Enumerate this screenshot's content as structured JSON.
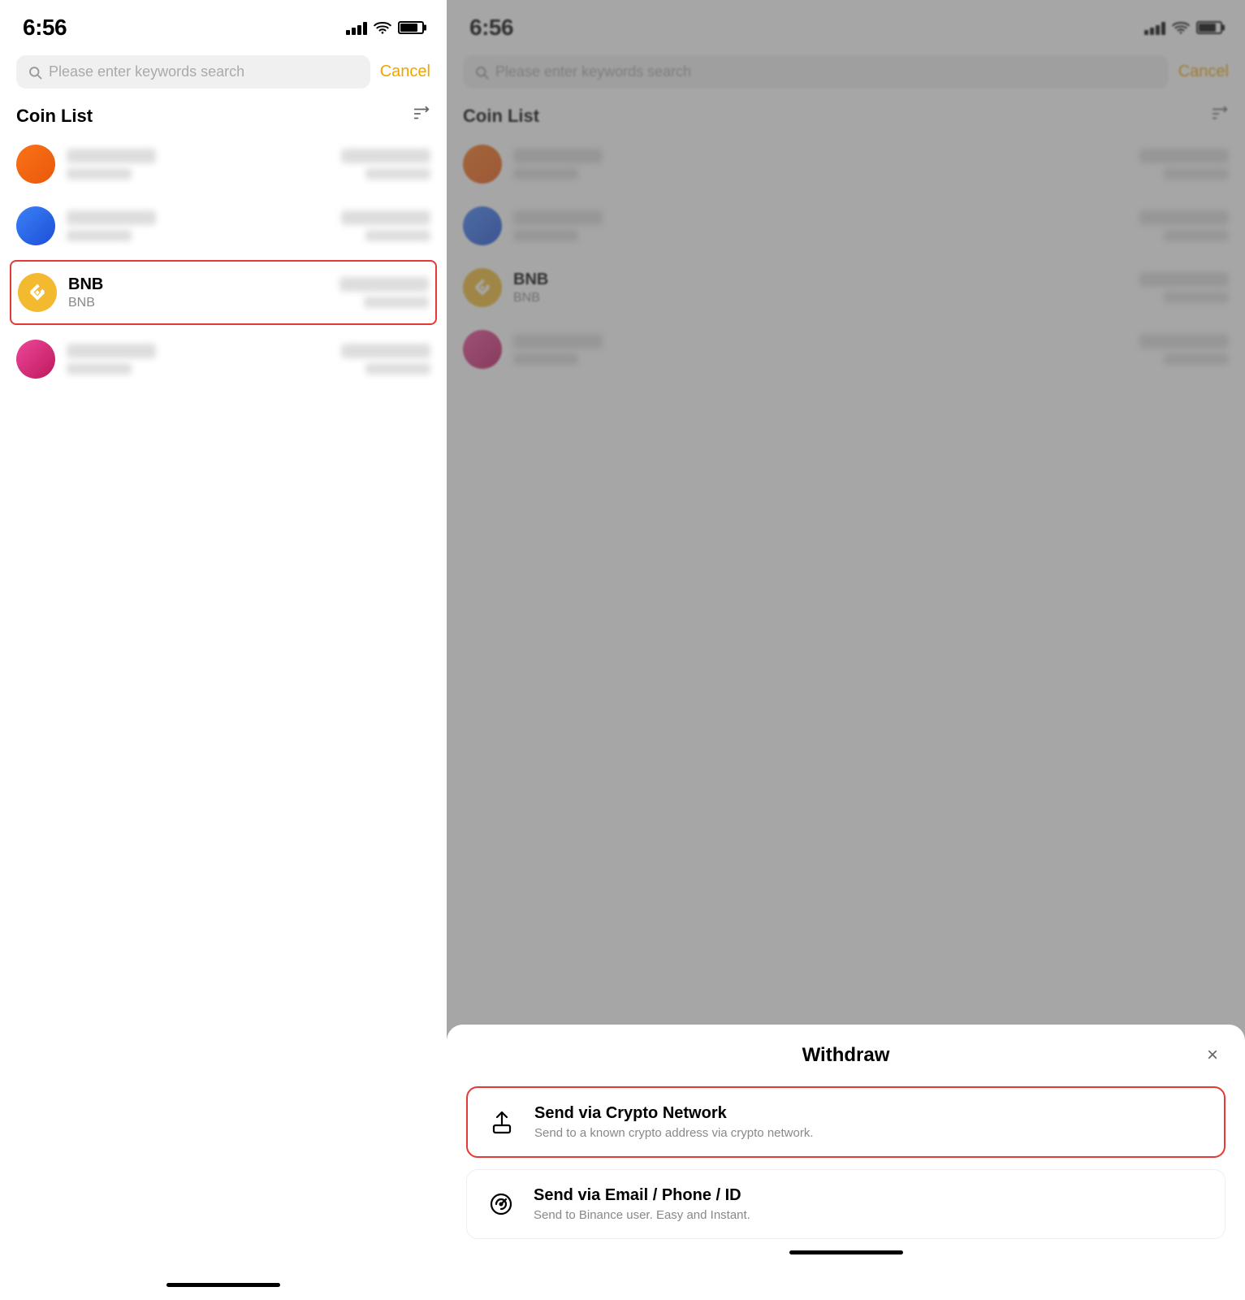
{
  "left_panel": {
    "status_bar": {
      "time": "6:56"
    },
    "search": {
      "placeholder": "Please enter keywords search",
      "cancel_label": "Cancel"
    },
    "coin_list": {
      "title": "Coin List",
      "coins": [
        {
          "id": "coin1",
          "color": "orange",
          "name": "",
          "symbol": "",
          "highlighted": false
        },
        {
          "id": "coin2",
          "color": "blue",
          "name": "",
          "symbol": "",
          "highlighted": false
        },
        {
          "id": "bnb",
          "color": "bnb",
          "name": "BNB",
          "symbol": "BNB",
          "highlighted": true
        },
        {
          "id": "coin4",
          "color": "pink",
          "name": "",
          "symbol": "",
          "highlighted": false
        }
      ]
    },
    "home_indicator": ""
  },
  "right_panel": {
    "status_bar": {
      "time": "6:56"
    },
    "search": {
      "placeholder": "Please enter keywords search",
      "cancel_label": "Cancel"
    },
    "coin_list": {
      "title": "Coin List",
      "coins": [
        {
          "id": "coin1r",
          "color": "orange",
          "name": "",
          "symbol": ""
        },
        {
          "id": "coin2r",
          "color": "blue",
          "name": "",
          "symbol": ""
        },
        {
          "id": "bnbr",
          "color": "bnb",
          "name": "BNB",
          "symbol": "BNB"
        },
        {
          "id": "coin4r",
          "color": "pink",
          "name": "",
          "symbol": ""
        }
      ]
    },
    "modal": {
      "title": "Withdraw",
      "close_label": "×",
      "options": [
        {
          "id": "crypto-network",
          "title": "Send via Crypto Network",
          "description": "Send to a known crypto address via crypto network.",
          "highlighted": true
        },
        {
          "id": "email-phone",
          "title": "Send via Email / Phone / ID",
          "description": "Send to Binance user. Easy and Instant.",
          "highlighted": false
        }
      ]
    }
  }
}
